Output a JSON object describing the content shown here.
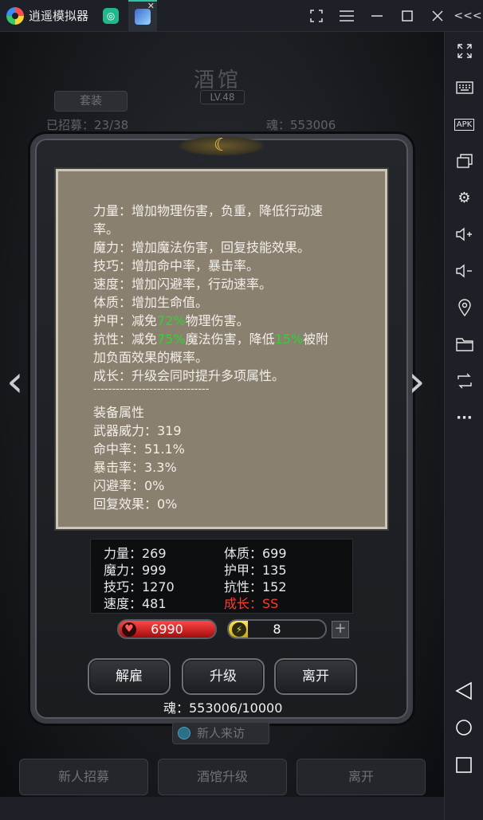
{
  "emulator": {
    "title": "逍遥模拟器",
    "buttons": [
      "fullscreen",
      "menu",
      "minimize",
      "maximize",
      "close",
      "collapse"
    ]
  },
  "sidebar": {
    "items": [
      "expand-icon",
      "keyboard-icon",
      "apk-install-icon",
      "multi-window-icon",
      "settings-icon",
      "volume-up-icon",
      "volume-down-icon",
      "location-icon",
      "folder-icon",
      "sync-icon",
      "more-icon"
    ],
    "apk_label": "APK",
    "more_label": "···"
  },
  "background": {
    "title": "酒馆",
    "level": "LV.48",
    "tab": "套装",
    "count_partial": "已招募：23/38",
    "soul_partial": "魂：553006"
  },
  "tooltip": {
    "lines": [
      "力量：增加物理伤害，负重，降低行动速",
      "率。",
      "魔力：增加魔法伤害，回复技能效果。",
      "技巧：增加命中率，暴击率。",
      "速度：增加闪避率，行动速率。",
      "体质：增加生命值。"
    ],
    "armor": {
      "prefix": "护甲：减免",
      "value": "72%",
      "suffix": "物理伤害。"
    },
    "resist": {
      "prefix": "抗性：减免",
      "value1": "75%",
      "mid": "魔法伤害，降低",
      "value2": "15%",
      "suffix": "被附"
    },
    "resist_cont": "加负面效果的概率。",
    "growth": "成长：升级会同时提升多项属性。",
    "divider": "-------------------------------",
    "equip_title": "装备属性",
    "equip": [
      "武器威力：319",
      "命中率：51.1%",
      "暴击率：3.3%",
      "闪避率：0%",
      "回复效果：0%"
    ]
  },
  "stats": {
    "left": [
      "力量：269",
      "魔力：999",
      "技巧：1270",
      "速度：481"
    ],
    "right": [
      "体质：699",
      "护甲：135",
      "抗性：152",
      "成长：SS"
    ]
  },
  "hp": {
    "value": "6990"
  },
  "energy": {
    "value": "8",
    "fill_fraction": 0.2
  },
  "plus": "+",
  "buttons": {
    "dismiss": "解雇",
    "upgrade": "升级",
    "leave": "离开"
  },
  "soul": "魂：553006/10000",
  "visitor": "新人来访",
  "bottom": {
    "recruit": "新人招募",
    "tavern_upgrade": "酒馆升级",
    "leave": "离开"
  },
  "colors": {
    "highlight_green": "#2ed42e",
    "growth_red": "#ff3b2f",
    "hp_red": "#d11a1a",
    "energy_yellow": "#ffd83a"
  }
}
